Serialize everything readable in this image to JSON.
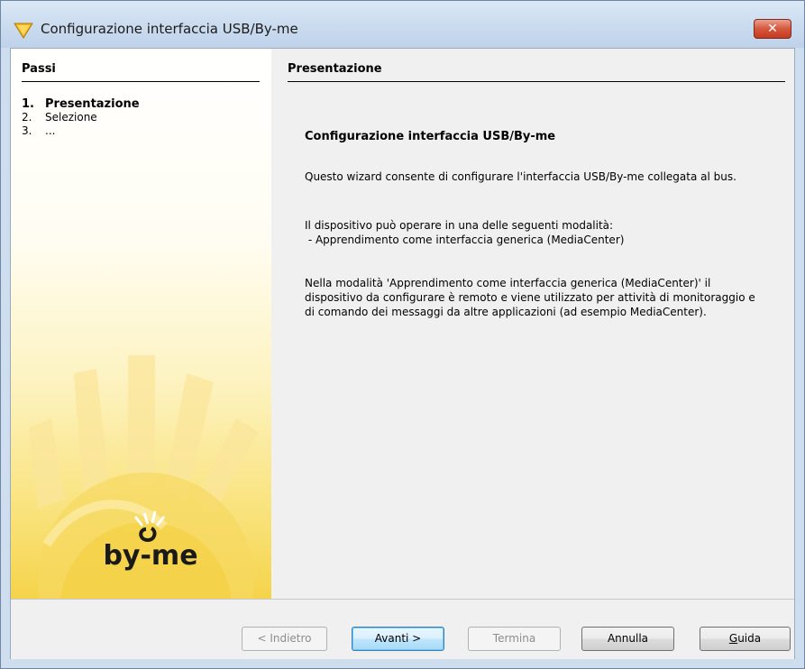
{
  "window": {
    "title": "Configurazione interfaccia USB/By-me",
    "close_label": "✕"
  },
  "sidebar": {
    "heading": "Passi",
    "steps": [
      {
        "num": "1.",
        "label": "Presentazione",
        "active": true
      },
      {
        "num": "2.",
        "label": "Selezione",
        "active": false
      },
      {
        "num": "3.",
        "label": "...",
        "active": false
      }
    ],
    "logo_text": "by-me"
  },
  "content": {
    "heading": "Presentazione",
    "title": "Configurazione interfaccia USB/By-me",
    "paragraph1": "Questo wizard consente di configurare l'interfaccia USB/By-me collegata al bus.",
    "paragraph2_line1": "Il dispositivo può operare in una delle seguenti modalità:",
    "paragraph2_line2": " - Apprendimento come interfaccia generica (MediaCenter)",
    "paragraph3": "Nella modalità 'Apprendimento come interfaccia generica (MediaCenter)' il dispositivo da configurare è remoto e viene utilizzato per attività di monitoraggio e di comando dei messaggi da altre applicazioni (ad esempio MediaCenter)."
  },
  "buttons": {
    "back": "< Indietro",
    "next": "Avanti >",
    "finish": "Termina",
    "cancel": "Annulla",
    "help_underlined": "G",
    "help_rest": "uida"
  },
  "colors": {
    "title_bar": "#c9daee",
    "close_button": "#d5573d",
    "sidebar_yellow": "#f9e27a",
    "default_button_border": "#3c7fb1"
  }
}
